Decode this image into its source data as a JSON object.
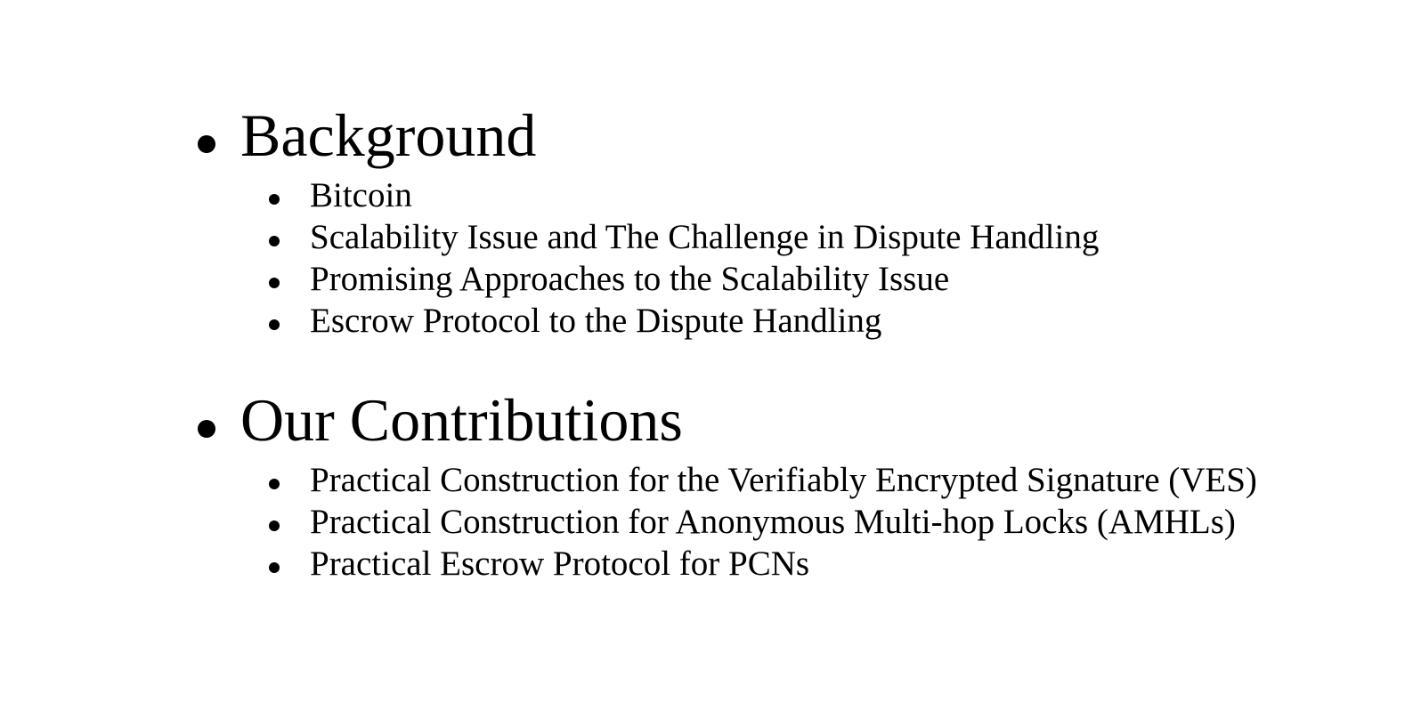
{
  "sections": [
    {
      "heading": "Background",
      "items": [
        "Bitcoin",
        "Scalability Issue and The Challenge in Dispute Handling",
        "Promising Approaches to the Scalability Issue",
        "Escrow Protocol to the Dispute Handling"
      ]
    },
    {
      "heading": "Our Contributions",
      "items": [
        "Practical Construction for the Verifiably Encrypted Signature (VES)",
        "Practical Construction for Anonymous Multi-hop Locks (AMHLs)",
        "Practical Escrow Protocol for PCNs"
      ]
    }
  ]
}
